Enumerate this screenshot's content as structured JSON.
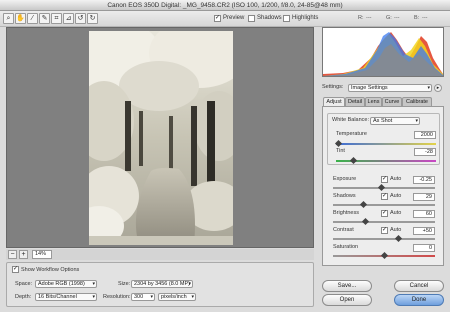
{
  "window": {
    "title": "Canon EOS 350D Digital: _MG_9458.CR2  (ISO 100, 1/200, f/8.0, 24-85@48 mm)"
  },
  "toolbar": {
    "tools": [
      {
        "name": "zoom-tool-icon",
        "glyph": "🔍"
      },
      {
        "name": "hand-tool-icon",
        "glyph": "✋"
      },
      {
        "name": "eyedropper-tool-icon",
        "glyph": "✎"
      },
      {
        "name": "color-sampler-tool-icon",
        "glyph": "✐"
      },
      {
        "name": "crop-tool-icon",
        "glyph": "⌗"
      },
      {
        "name": "straighten-tool-icon",
        "glyph": "⊿"
      },
      {
        "name": "rotate-left-icon",
        "glyph": "↺"
      },
      {
        "name": "rotate-right-icon",
        "glyph": "↻"
      }
    ],
    "preview_label": "Preview",
    "shadows_label": "Shadows",
    "highlights_label": "Highlights",
    "rgb": {
      "r": "R:",
      "g": "G:",
      "b": "B:",
      "r_val": "---",
      "g_val": "---",
      "b_val": "---"
    }
  },
  "zoom": {
    "level": "14%"
  },
  "workflow": {
    "show_label": "Show Workflow Options",
    "space_label": "Space:",
    "space_value": "Adobe RGB (1998)",
    "size_label": "Size:",
    "size_value": "2304 by 3456  (8.0 MP)",
    "depth_label": "Depth:",
    "depth_value": "16 Bits/Channel",
    "resolution_label": "Resolution:",
    "resolution_value": "300",
    "resolution_unit": "pixels/inch"
  },
  "settings": {
    "label": "Settings:",
    "value": "Image Settings"
  },
  "tabs": [
    "Adjust",
    "Detail",
    "Lens",
    "Curve",
    "Calibrate"
  ],
  "adjust": {
    "white_balance_label": "White Balance:",
    "white_balance_value": "As Shot",
    "temperature_label": "Temperature",
    "temperature_value": "2000",
    "tint_label": "Tint",
    "tint_value": "-28",
    "exposure_label": "Exposure",
    "exposure_auto": "Auto",
    "exposure_value": "-0.25",
    "shadows_label": "Shadows",
    "shadows_auto": "Auto",
    "shadows_value": "29",
    "brightness_label": "Brightness",
    "brightness_auto": "Auto",
    "brightness_value": "60",
    "contrast_label": "Contrast",
    "contrast_auto": "Auto",
    "contrast_value": "+50",
    "saturation_label": "Saturation",
    "saturation_value": "0"
  },
  "buttons": {
    "save": "Save...",
    "cancel": "Cancel",
    "open": "Open",
    "done": "Done"
  }
}
